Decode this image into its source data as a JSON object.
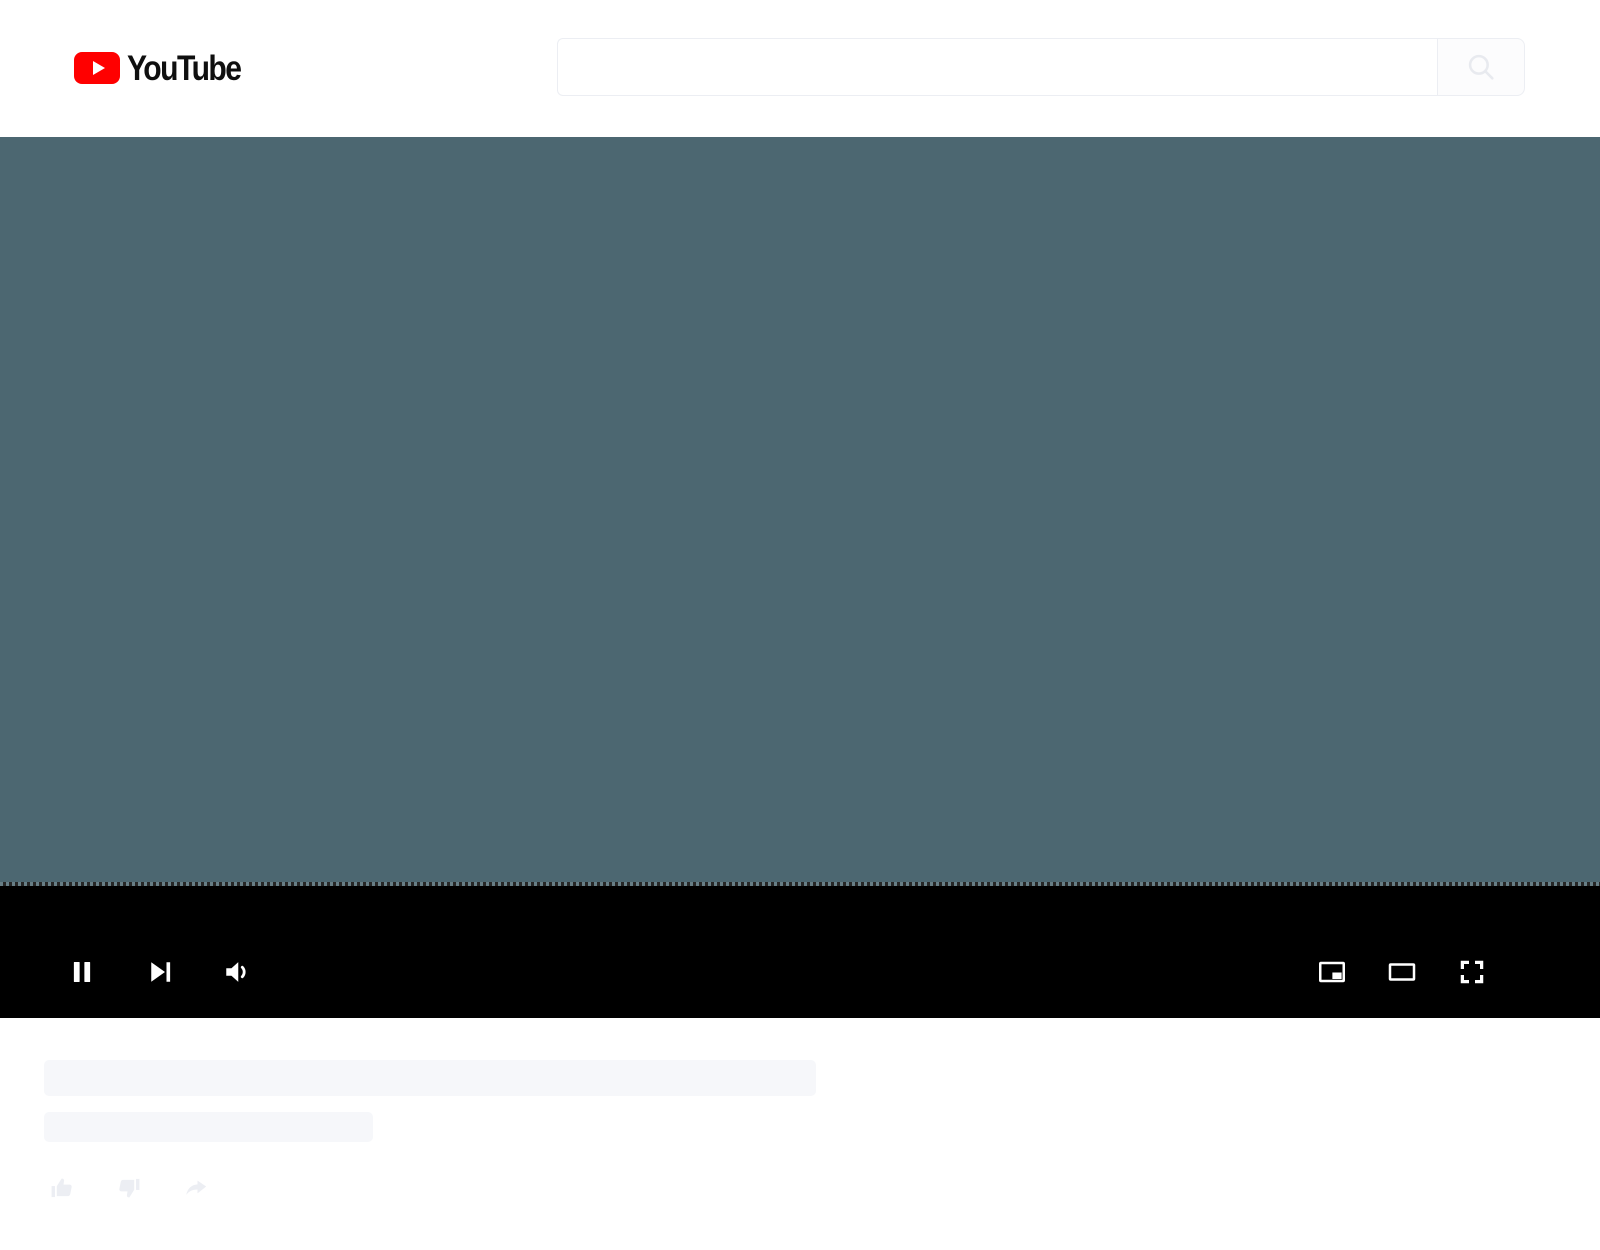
{
  "app": {
    "name": "YouTube",
    "brand_color": "#ff0000",
    "background": "#ffffff"
  },
  "header": {
    "logo": {
      "icon": "youtube-play-badge-icon",
      "wordmark": "YouTube"
    },
    "search": {
      "value": "",
      "placeholder": "",
      "button_icon": "search-icon",
      "button_label": "Search"
    }
  },
  "player": {
    "video_surface_color": "#4c6771",
    "control_bar_color": "#000000",
    "state": "playing",
    "controls_left": [
      {
        "name": "pause-button",
        "icon": "pause-icon",
        "label": "Pause"
      },
      {
        "name": "next-button",
        "icon": "next-track-icon",
        "label": "Next"
      },
      {
        "name": "volume-button",
        "icon": "volume-icon",
        "label": "Mute"
      }
    ],
    "controls_right": [
      {
        "name": "miniplayer-button",
        "icon": "miniplayer-icon",
        "label": "Miniplayer"
      },
      {
        "name": "theater-button",
        "icon": "theater-mode-icon",
        "label": "Theater mode"
      },
      {
        "name": "fullscreen-button",
        "icon": "fullscreen-icon",
        "label": "Full screen"
      }
    ]
  },
  "details": {
    "loading": true,
    "skeleton_color": "#f6f7fa",
    "title_placeholder": "",
    "subtitle_placeholder": "",
    "actions": [
      {
        "name": "like-button",
        "icon": "thumbs-up-icon",
        "label": "Like"
      },
      {
        "name": "dislike-button",
        "icon": "thumbs-down-icon",
        "label": "Dislike"
      },
      {
        "name": "share-button",
        "icon": "share-arrow-icon",
        "label": "Share"
      }
    ]
  }
}
